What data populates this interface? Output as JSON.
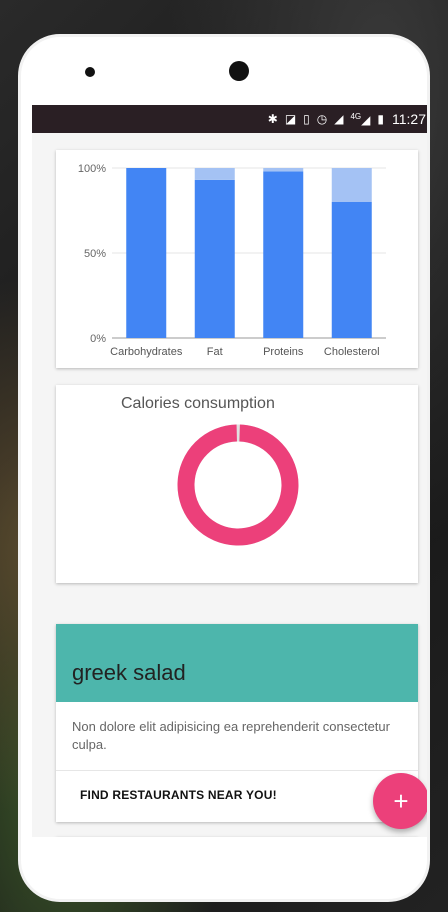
{
  "statusbar": {
    "icons": [
      "bluetooth-icon",
      "nfc-icon",
      "vibrate-icon",
      "alarm-icon",
      "signal-icon",
      "network-4g-icon",
      "battery-icon"
    ],
    "network_label": "4G",
    "time": "11:27"
  },
  "chart_data": {
    "type": "bar",
    "stacked": true,
    "categories": [
      "Carbohydrates",
      "Fat",
      "Proteins",
      "Cholesterol"
    ],
    "series": [
      {
        "name": "",
        "values": [
          100,
          93,
          98,
          80
        ],
        "color": "#4285f4"
      },
      {
        "name": "",
        "values": [
          0,
          7,
          2,
          20
        ],
        "color": "#a4c2f4"
      }
    ],
    "yticks": [
      "0%",
      "50%",
      "100%"
    ],
    "ylim": [
      0,
      100
    ],
    "grid": true
  },
  "calories": {
    "title": "Calories consumption",
    "chart": {
      "type": "pie",
      "style": "donut",
      "consumed_fraction": 0.99,
      "color": "#ec407a",
      "remainder_color": "#e0e0e0"
    }
  },
  "food": {
    "name": "greek salad",
    "description": "Non dolore elit adipisicing ea reprehenderit consectetur culpa.",
    "action": "FIND RESTAURANTS NEAR YOU!"
  },
  "fab": {
    "label": "+",
    "color": "#ec407a"
  }
}
